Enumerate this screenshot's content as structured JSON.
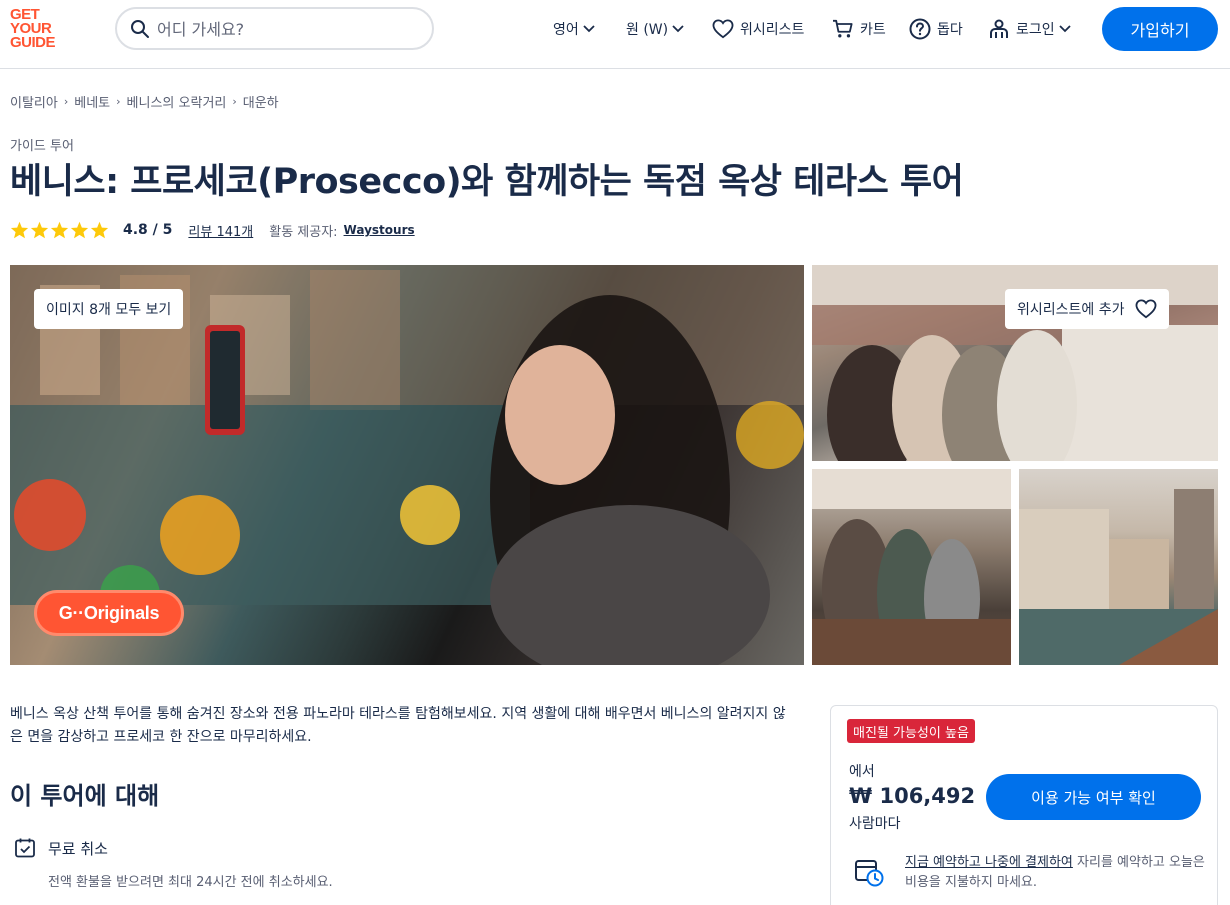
{
  "header": {
    "logo": [
      "GET",
      "YOUR",
      "GUIDE"
    ],
    "search_placeholder": "어디 가세요?",
    "language": "영어",
    "currency": "원 (W)",
    "wishlist": "위시리스트",
    "cart": "카트",
    "help": "돕다",
    "login": "로그인",
    "signup": "가입하기"
  },
  "breadcrumb": [
    "이탈리아",
    "베네토",
    "베니스의 오락거리",
    "대운하"
  ],
  "category": "가이드 투어",
  "title": "베니스: 프로세코(Prosecco)와 함께하는 독점 옥상 테라스 투어",
  "rating": {
    "stars": 5,
    "value": "4.8 / 5",
    "reviews": "리뷰 141개",
    "provider_label": "활동 제공자:",
    "provider": "Waystours"
  },
  "gallery": {
    "view_all": "이미지 8개 모두 보기",
    "add_wishlist": "위시리스트에 추가",
    "badge": "G··Originals"
  },
  "summary": "베니스 옥상 산책 투어를 통해 숨겨진 장소와 전용 파노라마 테라스를 탐험해보세요. 지역 생활에 대해 배우면서 베니스의 알려지지 않은 면을 감상하고 프로세코 한 잔으로 마무리하세요.",
  "about": {
    "heading": "이 투어에 대해",
    "features": [
      {
        "icon": "calendar-check-icon",
        "title": "무료 취소",
        "description": "전액 환불을 받으려면 최대 24시간 전에 취소하세요."
      }
    ]
  },
  "booking": {
    "badge": "매진될 가능성이 높음",
    "from_label": "에서",
    "price": "₩ 106,492",
    "per_person": "사람마다",
    "check_button": "이용 가능 여부 확인",
    "reserve_link": "지금 예약하고 나중에 결제하여",
    "reserve_text": " 자리를 예약하고 오늘은 비용을 지불하지 마세요."
  },
  "colors": {
    "accent": "#0071eb",
    "brand": "#ff5533",
    "star": "#fdc90a",
    "badge_red": "#d9263a",
    "text": "#1a2b49"
  }
}
